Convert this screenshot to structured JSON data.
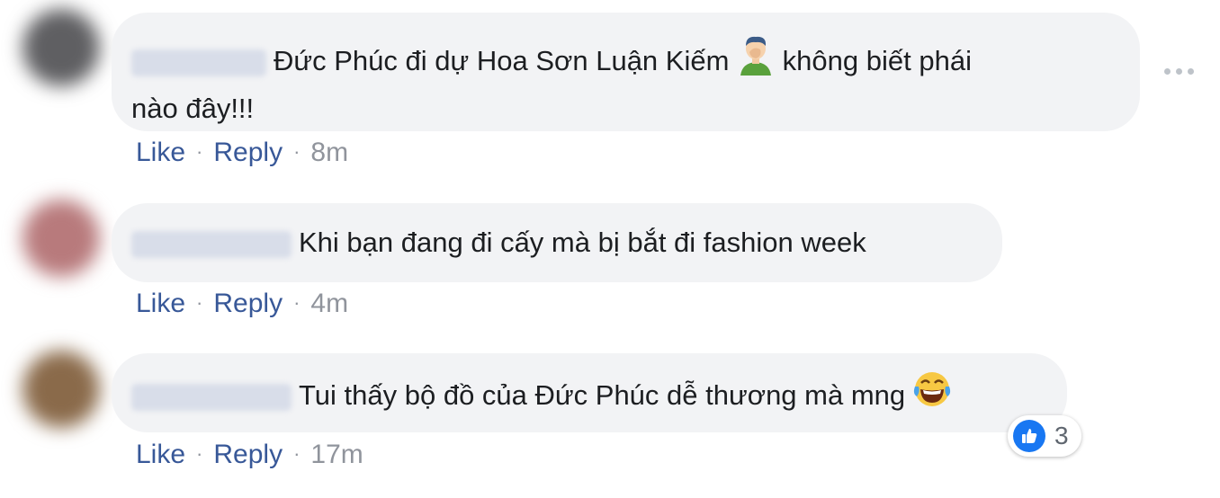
{
  "comments": [
    {
      "text_before_emoji": "Đức Phúc đi dự Hoa Sơn Luận Kiếm",
      "emoji": "man-facepalming-emoji",
      "text_after_emoji": "không biết phái",
      "text_line2": "nào đây!!!",
      "like_label": "Like",
      "reply_label": "Reply",
      "timestamp": "8m",
      "avatar_color": "#5f5f62"
    },
    {
      "text": "Khi bạn đang đi cấy mà bị bắt đi fashion week",
      "like_label": "Like",
      "reply_label": "Reply",
      "timestamp": "4m",
      "avatar_color": "#b87a7c"
    },
    {
      "text": "Tui thấy bộ đồ của Đức Phúc dễ thương mà mng",
      "emoji": "laughing-tears-emoji",
      "like_label": "Like",
      "reply_label": "Reply",
      "timestamp": "17m",
      "avatar_color": "#8a6a4a",
      "reaction": {
        "icon": "thumbs-up-icon",
        "count": "3"
      }
    }
  ],
  "separator": "·",
  "colors": {
    "bubble_bg": "#f2f3f5",
    "link": "#385898",
    "meta_gray": "#90949c",
    "like_blue": "#1877f2"
  }
}
